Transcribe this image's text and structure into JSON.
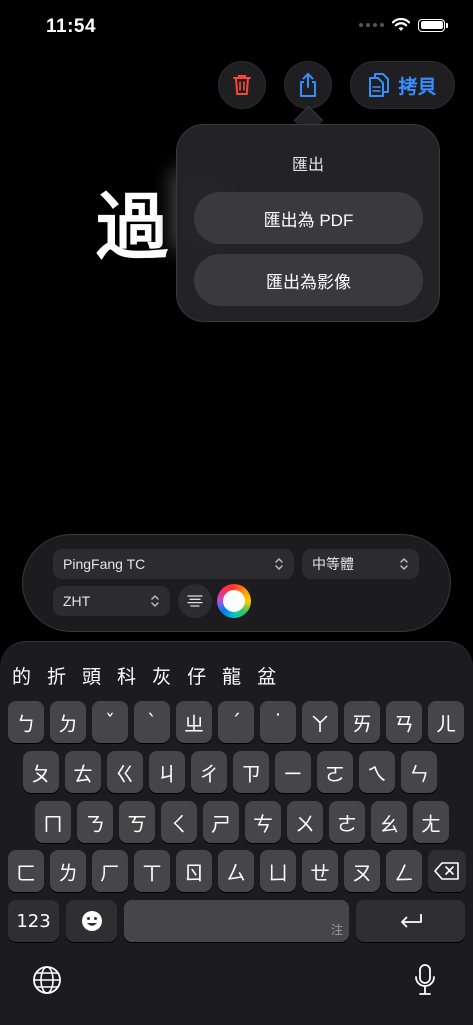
{
  "status": {
    "time": "11:54"
  },
  "toolbar": {
    "copy_label": "拷貝"
  },
  "canvas": {
    "text": "過"
  },
  "export_menu": {
    "title": "匯出",
    "items": [
      "匯出為 PDF",
      "匯出為影像"
    ]
  },
  "font_panel": {
    "font": "PingFang TC",
    "weight": "中等體",
    "language": "ZHT"
  },
  "keyboard": {
    "candidates": [
      "的",
      "折",
      "頭",
      "科",
      "灰",
      "仔",
      "龍",
      "盆"
    ],
    "row1": [
      "ㄅ",
      "ㄉ",
      "ˇ",
      "ˋ",
      "ㄓ",
      "ˊ",
      "˙",
      "ㄚ",
      "ㄞ",
      "ㄢ",
      "ㄦ"
    ],
    "row2": [
      "ㄆ",
      "ㄊ",
      "ㄍ",
      "ㄐ",
      "ㄔ",
      "ㄗ",
      "ㄧ",
      "ㄛ",
      "ㄟ",
      "ㄣ"
    ],
    "row3": [
      "ㄇ",
      "ㄋ",
      "ㄎ",
      "ㄑ",
      "ㄕ",
      "ㄘ",
      "ㄨ",
      "ㄜ",
      "ㄠ",
      "ㄤ"
    ],
    "row4": [
      "ㄈ",
      "ㄌ",
      "ㄏ",
      "ㄒ",
      "ㄖ",
      "ㄙ",
      "ㄩ",
      "ㄝ",
      "ㄡ",
      "ㄥ"
    ],
    "numbers_label": "123",
    "space_hint": "注"
  },
  "icons": [
    "wifi-icon",
    "battery-icon",
    "trash-icon",
    "share-icon",
    "copy-icon",
    "chevron-updown-icon",
    "align-center-icon",
    "color-wheel-icon",
    "emoji-icon",
    "return-icon",
    "delete-icon",
    "globe-icon",
    "mic-icon"
  ],
  "colors": {
    "accent": "#3a8dff",
    "danger": "#ff453a"
  }
}
